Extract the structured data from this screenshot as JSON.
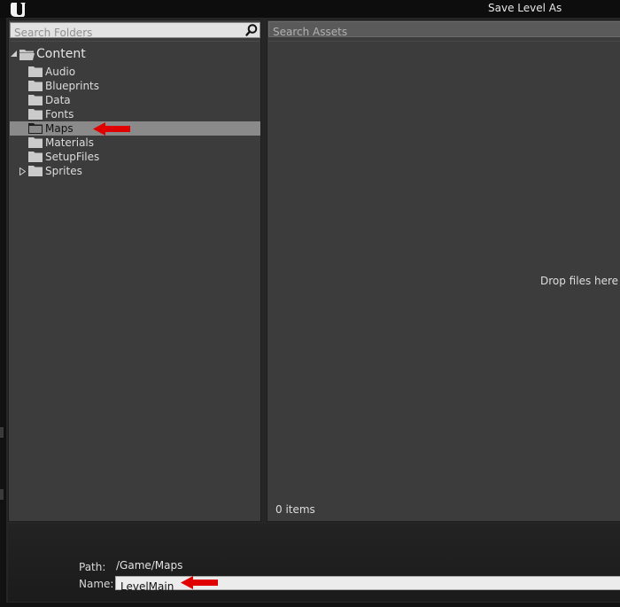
{
  "window": {
    "title": "Save Level As"
  },
  "folders": {
    "search_placeholder": "Search Folders",
    "root": "Content",
    "items": [
      {
        "label": "Audio",
        "expandable": false,
        "selected": false
      },
      {
        "label": "Blueprints",
        "expandable": false,
        "selected": false
      },
      {
        "label": "Data",
        "expandable": false,
        "selected": false
      },
      {
        "label": "Fonts",
        "expandable": false,
        "selected": false
      },
      {
        "label": "Maps",
        "expandable": false,
        "selected": true
      },
      {
        "label": "Materials",
        "expandable": false,
        "selected": false
      },
      {
        "label": "SetupFiles",
        "expandable": false,
        "selected": false
      },
      {
        "label": "Sprites",
        "expandable": true,
        "selected": false
      }
    ]
  },
  "assets": {
    "search_placeholder": "Search Assets",
    "drop_hint": "Drop files here or",
    "item_count": "0 items"
  },
  "footer": {
    "path_label": "Path:",
    "path_value": "/Game/Maps",
    "name_label": "Name:",
    "name_value": "LevelMain"
  },
  "colors": {
    "selection": "#8a8a8a",
    "annotation_arrow": "#e00000",
    "panel": "#3c3c3c"
  },
  "icons": {
    "logo": "unreal-logo",
    "search": "magnifier-icon",
    "folder": "folder-icon",
    "folder_open": "open-folder-icon",
    "expand": "triangle-expander-icon"
  }
}
